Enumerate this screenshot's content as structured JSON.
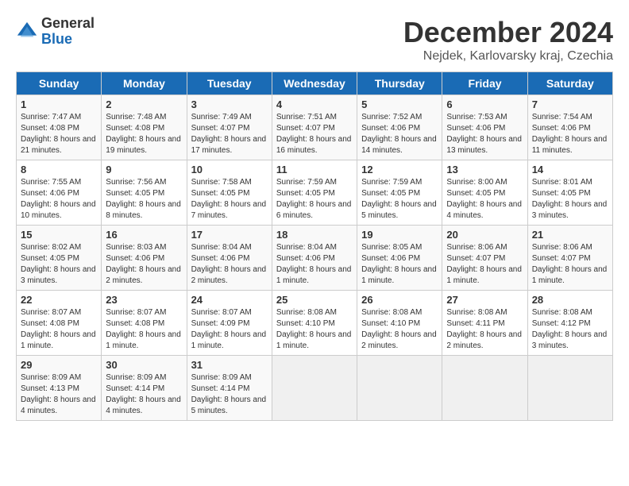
{
  "logo": {
    "general": "General",
    "blue": "Blue"
  },
  "title": "December 2024",
  "subtitle": "Nejdek, Karlovarsky kraj, Czechia",
  "days_header": [
    "Sunday",
    "Monday",
    "Tuesday",
    "Wednesday",
    "Thursday",
    "Friday",
    "Saturday"
  ],
  "weeks": [
    [
      {
        "day": "1",
        "sunrise": "7:47 AM",
        "sunset": "4:08 PM",
        "daylight": "8 hours and 21 minutes."
      },
      {
        "day": "2",
        "sunrise": "7:48 AM",
        "sunset": "4:08 PM",
        "daylight": "8 hours and 19 minutes."
      },
      {
        "day": "3",
        "sunrise": "7:49 AM",
        "sunset": "4:07 PM",
        "daylight": "8 hours and 17 minutes."
      },
      {
        "day": "4",
        "sunrise": "7:51 AM",
        "sunset": "4:07 PM",
        "daylight": "8 hours and 16 minutes."
      },
      {
        "day": "5",
        "sunrise": "7:52 AM",
        "sunset": "4:06 PM",
        "daylight": "8 hours and 14 minutes."
      },
      {
        "day": "6",
        "sunrise": "7:53 AM",
        "sunset": "4:06 PM",
        "daylight": "8 hours and 13 minutes."
      },
      {
        "day": "7",
        "sunrise": "7:54 AM",
        "sunset": "4:06 PM",
        "daylight": "8 hours and 11 minutes."
      }
    ],
    [
      {
        "day": "8",
        "sunrise": "7:55 AM",
        "sunset": "4:06 PM",
        "daylight": "8 hours and 10 minutes."
      },
      {
        "day": "9",
        "sunrise": "7:56 AM",
        "sunset": "4:05 PM",
        "daylight": "8 hours and 8 minutes."
      },
      {
        "day": "10",
        "sunrise": "7:58 AM",
        "sunset": "4:05 PM",
        "daylight": "8 hours and 7 minutes."
      },
      {
        "day": "11",
        "sunrise": "7:59 AM",
        "sunset": "4:05 PM",
        "daylight": "8 hours and 6 minutes."
      },
      {
        "day": "12",
        "sunrise": "7:59 AM",
        "sunset": "4:05 PM",
        "daylight": "8 hours and 5 minutes."
      },
      {
        "day": "13",
        "sunrise": "8:00 AM",
        "sunset": "4:05 PM",
        "daylight": "8 hours and 4 minutes."
      },
      {
        "day": "14",
        "sunrise": "8:01 AM",
        "sunset": "4:05 PM",
        "daylight": "8 hours and 3 minutes."
      }
    ],
    [
      {
        "day": "15",
        "sunrise": "8:02 AM",
        "sunset": "4:05 PM",
        "daylight": "8 hours and 3 minutes."
      },
      {
        "day": "16",
        "sunrise": "8:03 AM",
        "sunset": "4:06 PM",
        "daylight": "8 hours and 2 minutes."
      },
      {
        "day": "17",
        "sunrise": "8:04 AM",
        "sunset": "4:06 PM",
        "daylight": "8 hours and 2 minutes."
      },
      {
        "day": "18",
        "sunrise": "8:04 AM",
        "sunset": "4:06 PM",
        "daylight": "8 hours and 1 minute."
      },
      {
        "day": "19",
        "sunrise": "8:05 AM",
        "sunset": "4:06 PM",
        "daylight": "8 hours and 1 minute."
      },
      {
        "day": "20",
        "sunrise": "8:06 AM",
        "sunset": "4:07 PM",
        "daylight": "8 hours and 1 minute."
      },
      {
        "day": "21",
        "sunrise": "8:06 AM",
        "sunset": "4:07 PM",
        "daylight": "8 hours and 1 minute."
      }
    ],
    [
      {
        "day": "22",
        "sunrise": "8:07 AM",
        "sunset": "4:08 PM",
        "daylight": "8 hours and 1 minute."
      },
      {
        "day": "23",
        "sunrise": "8:07 AM",
        "sunset": "4:08 PM",
        "daylight": "8 hours and 1 minute."
      },
      {
        "day": "24",
        "sunrise": "8:07 AM",
        "sunset": "4:09 PM",
        "daylight": "8 hours and 1 minute."
      },
      {
        "day": "25",
        "sunrise": "8:08 AM",
        "sunset": "4:10 PM",
        "daylight": "8 hours and 1 minute."
      },
      {
        "day": "26",
        "sunrise": "8:08 AM",
        "sunset": "4:10 PM",
        "daylight": "8 hours and 2 minutes."
      },
      {
        "day": "27",
        "sunrise": "8:08 AM",
        "sunset": "4:11 PM",
        "daylight": "8 hours and 2 minutes."
      },
      {
        "day": "28",
        "sunrise": "8:08 AM",
        "sunset": "4:12 PM",
        "daylight": "8 hours and 3 minutes."
      }
    ],
    [
      {
        "day": "29",
        "sunrise": "8:09 AM",
        "sunset": "4:13 PM",
        "daylight": "8 hours and 4 minutes."
      },
      {
        "day": "30",
        "sunrise": "8:09 AM",
        "sunset": "4:14 PM",
        "daylight": "8 hours and 4 minutes."
      },
      {
        "day": "31",
        "sunrise": "8:09 AM",
        "sunset": "4:14 PM",
        "daylight": "8 hours and 5 minutes."
      },
      null,
      null,
      null,
      null
    ]
  ]
}
